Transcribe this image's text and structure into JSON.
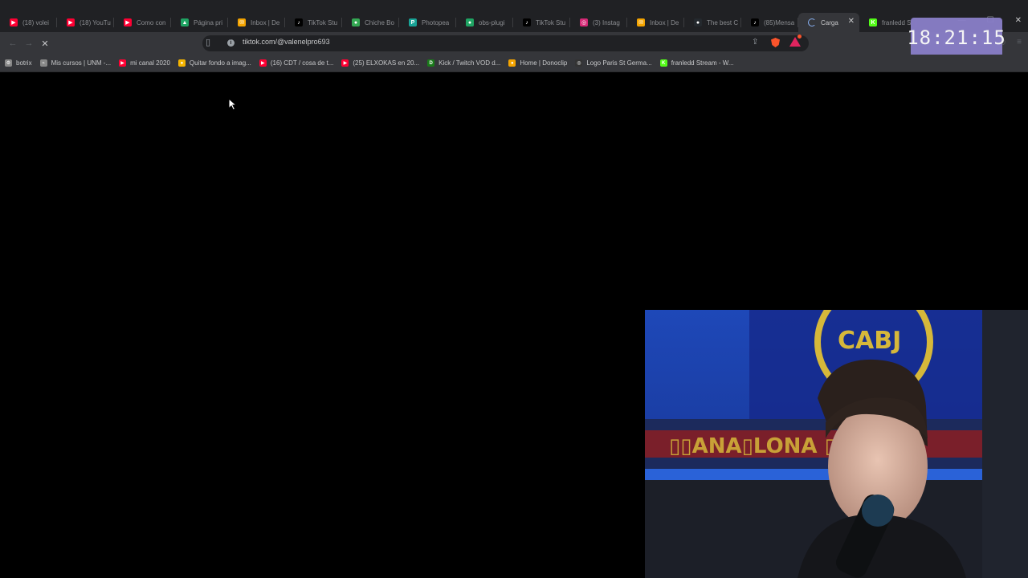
{
  "browser": {
    "tabs": [
      {
        "label": "(18) volei",
        "icon": "youtube-icon",
        "color": "#ff0033",
        "glyph": "▶"
      },
      {
        "label": "(18) YouTu",
        "icon": "youtube-icon",
        "color": "#ff0033",
        "glyph": "▶"
      },
      {
        "label": "Como con",
        "icon": "youtube-icon",
        "color": "#ff0033",
        "glyph": "▶"
      },
      {
        "label": "Página pri",
        "icon": "google-drive-icon",
        "color": "#1fa463",
        "glyph": "▲"
      },
      {
        "label": "Inbox | De",
        "icon": "mail-icon",
        "color": "#f4a400",
        "glyph": "✉"
      },
      {
        "label": "TikTok Stu",
        "icon": "tiktok-icon",
        "color": "#000000",
        "glyph": "♪"
      },
      {
        "label": "Chiche Bo",
        "icon": "maps-pin-icon",
        "color": "#34a853",
        "glyph": "●"
      },
      {
        "label": "Photopea",
        "icon": "photopea-icon",
        "color": "#18a497",
        "glyph": "P"
      },
      {
        "label": "obs-plugi",
        "icon": "obs-icon",
        "color": "#1fa463",
        "glyph": "●"
      },
      {
        "label": "TikTok Stu",
        "icon": "tiktok-icon",
        "color": "#000000",
        "glyph": "♪"
      },
      {
        "label": "(3) Instag",
        "icon": "instagram-icon",
        "color": "#d62976",
        "glyph": "◎"
      },
      {
        "label": "Inbox | De",
        "icon": "mail-icon",
        "color": "#f4a400",
        "glyph": "✉"
      },
      {
        "label": "The best C",
        "icon": "github-icon",
        "color": "#24292e",
        "glyph": "●"
      },
      {
        "label": "(85)Mensa",
        "icon": "tiktok-icon",
        "color": "#000000",
        "glyph": "♪"
      },
      {
        "label": "Carga",
        "icon": "loading-spinner-icon",
        "color": "#8ab4f8",
        "glyph": "",
        "active": true
      },
      {
        "label": "franledd S",
        "icon": "kick-icon",
        "color": "#53fc18",
        "glyph": "K"
      }
    ],
    "url": "tiktok.com/@valenelpro693",
    "clock": "18:21:15",
    "bookmarks": [
      {
        "label": "botrix",
        "icon": "settings-icon",
        "color": "#888888",
        "glyph": "⚙"
      },
      {
        "label": "Mis cursos | UNM -...",
        "icon": "link-icon",
        "color": "#888888",
        "glyph": "⌁"
      },
      {
        "label": "mi canal 2020",
        "icon": "youtube-icon",
        "color": "#ff0033",
        "glyph": "▶"
      },
      {
        "label": "Quitar fondo a imag...",
        "icon": "removebg-icon",
        "color": "#f4b400",
        "glyph": "●"
      },
      {
        "label": "(16) CDT / cosa de t...",
        "icon": "youtube-icon",
        "color": "#ff0033",
        "glyph": "▶"
      },
      {
        "label": "(25) ELXOKAS en 20...",
        "icon": "youtube-icon",
        "color": "#ff0033",
        "glyph": "▶"
      },
      {
        "label": "Kick / Twitch VOD d...",
        "icon": "kick-icon",
        "color": "#1a7a1a",
        "glyph": "D"
      },
      {
        "label": "Home | Donoclip",
        "icon": "donoclip-icon",
        "color": "#f4a400",
        "glyph": "●"
      },
      {
        "label": "Logo Paris St Germa...",
        "icon": "psg-icon",
        "color": "#333333",
        "glyph": "◎"
      },
      {
        "label": "franledd Stream - W...",
        "icon": "kick-icon",
        "color": "#53fc18",
        "glyph": "K"
      }
    ]
  }
}
